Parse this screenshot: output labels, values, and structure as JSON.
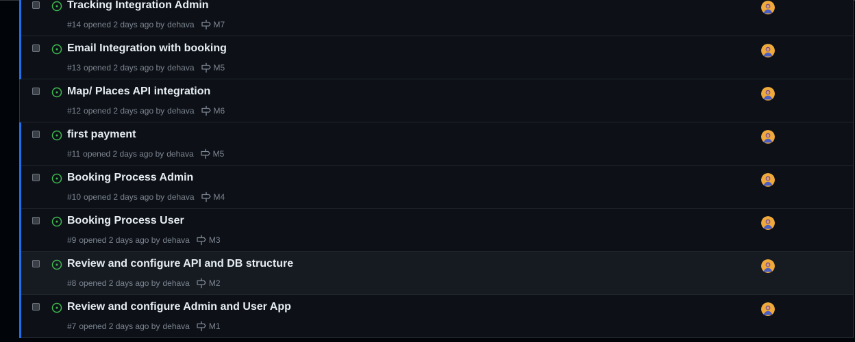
{
  "issues": [
    {
      "title": "Tracking Integration Admin",
      "number": "#14",
      "opened_text": "opened 2 days ago by",
      "author": "dehava",
      "milestone": "M7",
      "unread": true,
      "hover": false
    },
    {
      "title": "Email Integration with booking",
      "number": "#13",
      "opened_text": "opened 2 days ago by",
      "author": "dehava",
      "milestone": "M5",
      "unread": true,
      "hover": false
    },
    {
      "title": "Map/ Places API integration",
      "number": "#12",
      "opened_text": "opened 2 days ago by",
      "author": "dehava",
      "milestone": "M6",
      "unread": false,
      "hover": false
    },
    {
      "title": "first payment",
      "number": "#11",
      "opened_text": "opened 2 days ago by",
      "author": "dehava",
      "milestone": "M5",
      "unread": true,
      "hover": false
    },
    {
      "title": "Booking Process Admin",
      "number": "#10",
      "opened_text": "opened 2 days ago by",
      "author": "dehava",
      "milestone": "M4",
      "unread": true,
      "hover": false
    },
    {
      "title": "Booking Process User",
      "number": "#9",
      "opened_text": "opened 2 days ago by",
      "author": "dehava",
      "milestone": "M3",
      "unread": true,
      "hover": false
    },
    {
      "title": "Review and configure API and DB structure",
      "number": "#8",
      "opened_text": "opened 2 days ago by",
      "author": "dehava",
      "milestone": "M2",
      "unread": true,
      "hover": true
    },
    {
      "title": "Review and configure Admin and User App",
      "number": "#7",
      "opened_text": "opened 2 days ago by",
      "author": "dehava",
      "milestone": "M1",
      "unread": true,
      "hover": false
    }
  ],
  "icons": {
    "status": "issue-opened-icon",
    "milestone": "milestone-icon",
    "avatar": "assignee-avatar"
  },
  "colors": {
    "background": "#0d1117",
    "open_status": "#3fb950",
    "unread_bar": "#1f6feb",
    "title_text": "#e6edf3",
    "meta_text": "#7d8590"
  }
}
